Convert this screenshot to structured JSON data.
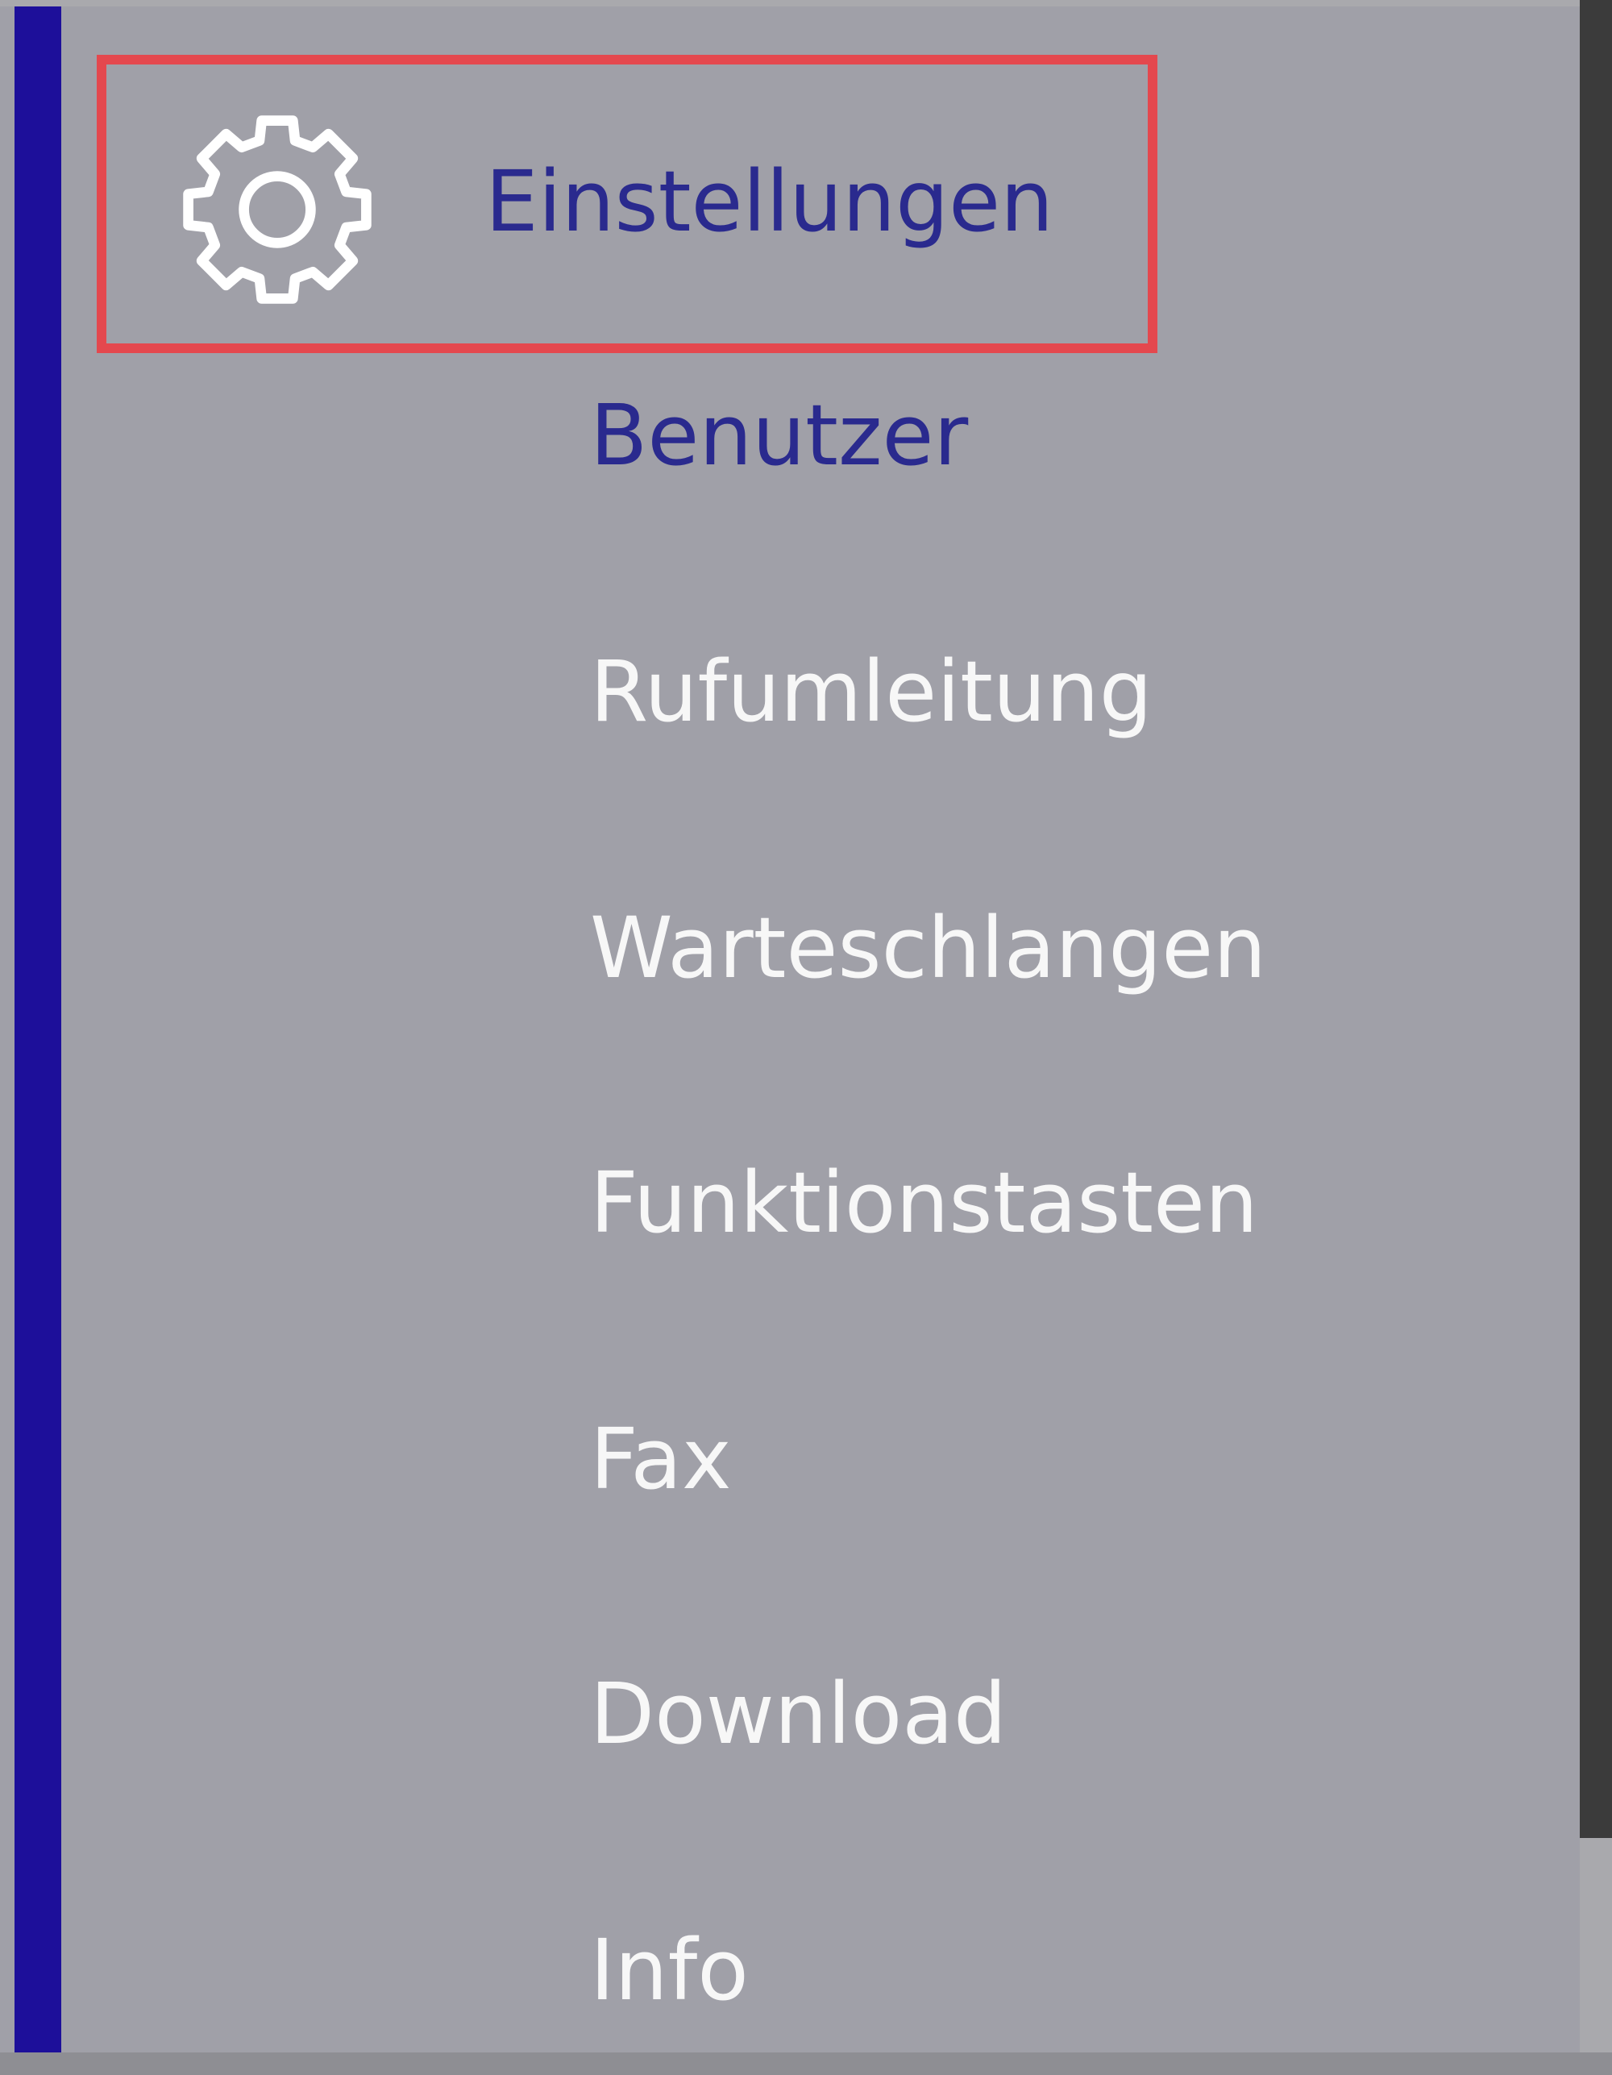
{
  "menu": {
    "section": {
      "label": "Einstellungen",
      "icon": "gear-icon"
    },
    "items": [
      {
        "label": "Benutzer",
        "active": true
      },
      {
        "label": "Rufumleitung",
        "active": false
      },
      {
        "label": "Warteschlangen",
        "active": false
      },
      {
        "label": "Funktionstasten",
        "active": false
      },
      {
        "label": "Fax",
        "active": false
      },
      {
        "label": "Download",
        "active": false
      },
      {
        "label": "Info",
        "active": false
      }
    ]
  },
  "colors": {
    "panel_background": "#a0a0a8",
    "accent_bar": "#1d0f9a",
    "active_text": "#2a2a8e",
    "inactive_text": "#f7f7f7",
    "highlight_border": "#e4484e"
  }
}
